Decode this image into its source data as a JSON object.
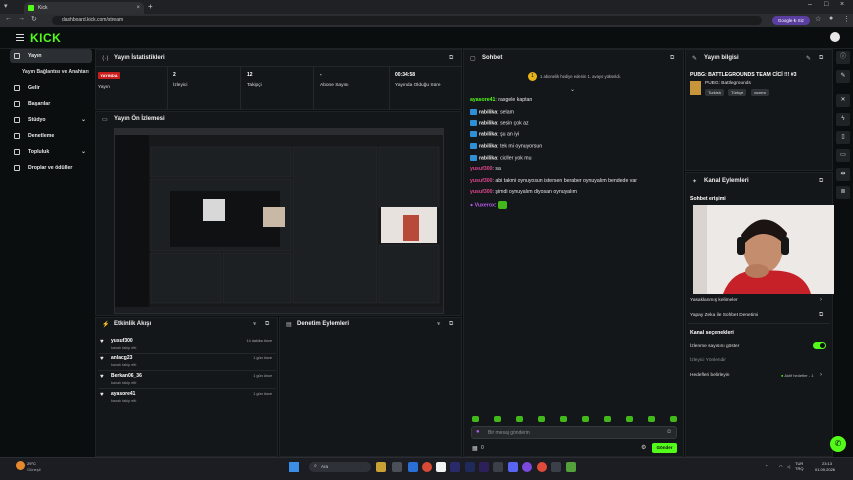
{
  "browser": {
    "tab_title": "Kick",
    "url": "dashboard.kick.com/stream",
    "google_button": "Google ₺ Siz"
  },
  "brand": {
    "logo": "KICK",
    "accent": "#53fc18"
  },
  "sidebar": {
    "items": [
      {
        "label": "Yayın"
      },
      {
        "label": "Yayın Bağlantısı ve Anahtarı"
      },
      {
        "label": "Gelir"
      },
      {
        "label": "Başarılar"
      },
      {
        "label": "Stüdyo"
      },
      {
        "label": "Denetleme"
      },
      {
        "label": "Topluluk"
      },
      {
        "label": "Droplar ve ödüller"
      }
    ]
  },
  "stats": {
    "title": "Yayın İstatistikleri",
    "live_badge": "YAYINDA",
    "cells": [
      {
        "value": "",
        "label": "Yayın"
      },
      {
        "value": "2",
        "label": "İzleyici"
      },
      {
        "value": "12",
        "label": "Takipçi"
      },
      {
        "value": "-",
        "label": "Abone Sayısı"
      },
      {
        "value": "00:34:58",
        "label": "Yayında Olduğu Süre"
      }
    ]
  },
  "preview": {
    "title": "Yayın Ön İzlemesi"
  },
  "feed": {
    "title": "Etkinlik Akışı",
    "items": [
      {
        "user": "yusuf300",
        "action": "kanalı takip etti",
        "time": "14 dakika önce"
      },
      {
        "user": "anlacg23",
        "action": "kanalı takip etti",
        "time": "1 gün önce"
      },
      {
        "user": "Berkan06_36",
        "action": "kanalı takip etti",
        "time": "1 gün önce"
      },
      {
        "user": "ayasore41",
        "action": "kanalı takip etti",
        "time": "1 gün önce"
      }
    ]
  },
  "moderation": {
    "title": "Denetim Eylemleri"
  },
  "chat": {
    "title": "Sohbet",
    "notice": "1 abonelik hediye edenin 1. avayo yükseldi.",
    "messages": [
      {
        "user": "ayasore41",
        "text": "rasgele kaptan",
        "color": "#53fc18",
        "badge": false
      },
      {
        "user": "rabilika",
        "text": "selam",
        "color": "#e6e6e6",
        "badge": true
      },
      {
        "user": "rabilika",
        "text": "sesin çok az",
        "color": "#e6e6e6",
        "badge": true
      },
      {
        "user": "rabilika",
        "text": "şu an iyi",
        "color": "#e6e6e6",
        "badge": true
      },
      {
        "user": "rabilika",
        "text": "tek mi oynuyorsun",
        "color": "#e6e6e6",
        "badge": true
      },
      {
        "user": "rabilika",
        "text": "cicller yok mu",
        "color": "#e6e6e6",
        "badge": true
      },
      {
        "user": "yusuf300",
        "text": "sa",
        "color": "#e0458f",
        "badge": false
      },
      {
        "user": "yusuf300",
        "text": "abi takmi oynuyosun istersen beraber oynuyalım bendede var",
        "color": "#e0458f",
        "badge": false
      },
      {
        "user": "yusuf300",
        "text": "şimdi oynuyalım diyosan oynuyalım",
        "color": "#e0458f",
        "badge": false
      },
      {
        "user": "Vuxerox",
        "text": "",
        "color": "#b65cf0",
        "badge": false
      }
    ],
    "input_placeholder": "Bir mesaj gönderin",
    "counter": "0",
    "send_label": "Gönder"
  },
  "info": {
    "title": "Yayın bilgisi",
    "stream_title": "PUBG: BATTLEGROUNDS TEAM CİCİ !!! #3",
    "category": "PUBG: Battlegrounds",
    "tags": [
      "Turkish",
      "Türkçe",
      "vuxero"
    ]
  },
  "channel": {
    "title": "Kanal Eylemleri",
    "chat_access": "Sohbet erişimi",
    "banned_words": "Yasaklanmış kelimeler",
    "ai_moderation": "Yapay Zeka ile Sohbet Denetimi",
    "options_title": "Kanal seçenekleri",
    "show_viewers": "İzlenme sayısını göster",
    "raid": "İzleyici Yönlendir",
    "goals": "Hedefleri belirleyin",
    "goals_value": "Aktif hedefler - 1"
  },
  "taskbar": {
    "weather_temp": "29°C",
    "weather_desc": "Güneşli",
    "search": "Ara",
    "lang": "TUR\nTRQ",
    "time": "23:13",
    "date": "01.09.2026"
  }
}
